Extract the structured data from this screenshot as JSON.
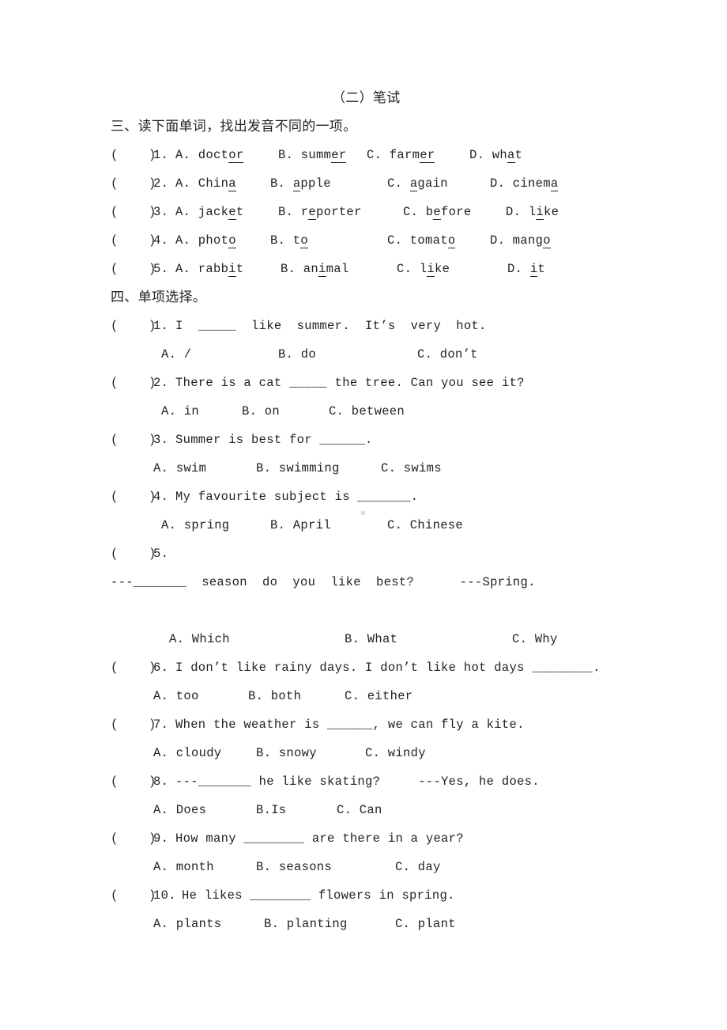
{
  "title": "（二）笔试",
  "section3": {
    "heading": "三、读下面单词，找出发音不同的一项。",
    "items": [
      {
        "num": "1.",
        "options": [
          {
            "label": "A.",
            "pre": "doct",
            "u": "or",
            "post": ""
          },
          {
            "label": "B.",
            "pre": "summ",
            "u": "er",
            "post": ""
          },
          {
            "label": "C.",
            "pre": "farm",
            "u": "er",
            "post": ""
          },
          {
            "label": "D.",
            "pre": "wh",
            "u": "a",
            "post": "t"
          }
        ]
      },
      {
        "num": "2.",
        "options": [
          {
            "label": "A.",
            "pre": "Chin",
            "u": "a",
            "post": ""
          },
          {
            "label": "B.",
            "pre": "",
            "u": "a",
            "post": "pple"
          },
          {
            "label": "C.",
            "pre": "",
            "u": "a",
            "post": "gain"
          },
          {
            "label": "D.",
            "pre": "cinem",
            "u": "a",
            "post": ""
          }
        ]
      },
      {
        "num": "3.",
        "options": [
          {
            "label": "A.",
            "pre": "jack",
            "u": "e",
            "post": "t"
          },
          {
            "label": "B.",
            "pre": "r",
            "u": "e",
            "post": "porter"
          },
          {
            "label": "C.",
            "pre": "b",
            "u": "e",
            "post": "fore"
          },
          {
            "label": "D.",
            "pre": "l",
            "u": "i",
            "post": "ke"
          }
        ]
      },
      {
        "num": "4.",
        "options": [
          {
            "label": "A.",
            "pre": "phot",
            "u": "o",
            "post": ""
          },
          {
            "label": "B.",
            "pre": "t",
            "u": "o",
            "post": ""
          },
          {
            "label": "C.",
            "pre": "tomat",
            "u": "o",
            "post": ""
          },
          {
            "label": "D.",
            "pre": "mang",
            "u": "o",
            "post": ""
          }
        ]
      },
      {
        "num": "5.",
        "options": [
          {
            "label": "A.",
            "pre": "rabb",
            "u": "i",
            "post": "t"
          },
          {
            "label": "B.",
            "pre": "an",
            "u": "i",
            "post": "mal"
          },
          {
            "label": "C.",
            "pre": "l",
            "u": "i",
            "post": "ke"
          },
          {
            "label": "D.",
            "pre": "",
            "u": "i",
            "post": "t"
          }
        ]
      }
    ]
  },
  "section4": {
    "heading": "四、单项选择。",
    "items": [
      {
        "num": "1.",
        "question": "I  _____  like  summer.  It’s  very  hot.",
        "options": [
          "A. /",
          "B. do",
          "C. don’t"
        ]
      },
      {
        "num": "2.",
        "question": "There is a cat _____ the tree. Can you see it?",
        "options": [
          "A. in",
          "B. on",
          "C. between"
        ]
      },
      {
        "num": "3.",
        "question": "Summer is best for ______.",
        "options": [
          "A. swim",
          "B. swimming",
          "C. swims"
        ]
      },
      {
        "num": "4.",
        "question": "My favourite subject is _______.",
        "options": [
          "A. spring",
          "B. April",
          "C. Chinese"
        ]
      },
      {
        "num": "5.",
        "question": "",
        "question_line2": "---_______  season  do  you  like  best?      ---Spring.",
        "options": [
          "A. Which",
          "B. What",
          "C. Why"
        ]
      },
      {
        "num": "6.",
        "question": "I don’t like rainy days. I don’t like hot days ________.",
        "options": [
          "A. too",
          "B. both",
          "C. either"
        ]
      },
      {
        "num": "7.",
        "question": "When the weather is ______, we can fly a kite.",
        "options": [
          "A. cloudy",
          "B. snowy",
          "C. windy"
        ]
      },
      {
        "num": "8.",
        "question": "---_______ he like skating?     ---Yes, he does.",
        "options": [
          "A. Does",
          "B.Is",
          "C. Can"
        ]
      },
      {
        "num": "9.",
        "question": "How many ________ are there in a year?",
        "options": [
          "A. month",
          "B. seasons",
          "C. day"
        ]
      },
      {
        "num": "10.",
        "question": "He likes ________ flowers in spring.",
        "options": [
          "A. plants",
          "B. planting",
          "C. plant"
        ]
      }
    ]
  },
  "answer_bracket": "(    )"
}
